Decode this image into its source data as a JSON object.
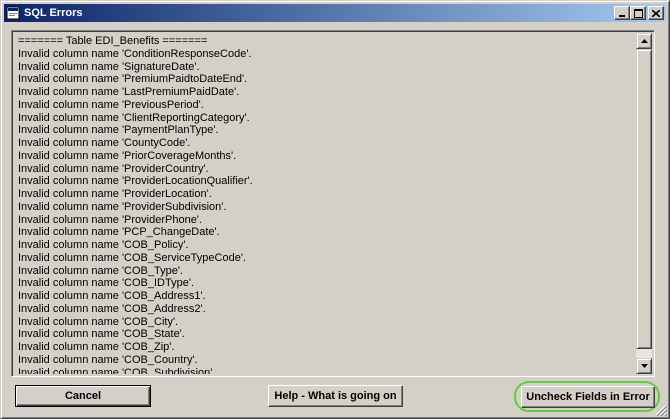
{
  "window": {
    "title": "SQL Errors",
    "controls": {
      "minimize": "minimize-icon",
      "maximize": "maximize-icon",
      "close": "close-icon"
    }
  },
  "log": {
    "lines": [
      "======= Table EDI_Benefits =======",
      "Invalid column name 'ConditionResponseCode'.",
      "Invalid column name 'SignatureDate'.",
      "Invalid column name 'PremiumPaidtoDateEnd'.",
      "Invalid column name 'LastPremiumPaidDate'.",
      "Invalid column name 'PreviousPeriod'.",
      "Invalid column name 'ClientReportingCategory'.",
      "Invalid column name 'PaymentPlanType'.",
      "Invalid column name 'CountyCode'.",
      "Invalid column name 'PriorCoverageMonths'.",
      "Invalid column name 'ProviderCountry'.",
      "Invalid column name 'ProviderLocationQualifier'.",
      "Invalid column name 'ProviderLocation'.",
      "Invalid column name 'ProviderSubdivision'.",
      "Invalid column name 'ProviderPhone'.",
      "Invalid column name 'PCP_ChangeDate'.",
      "Invalid column name 'COB_Policy'.",
      "Invalid column name 'COB_ServiceTypeCode'.",
      "Invalid column name 'COB_Type'.",
      "Invalid column name 'COB_IDType'.",
      "Invalid column name 'COB_Address1'.",
      "Invalid column name 'COB_Address2'.",
      "Invalid column name 'COB_City'.",
      "Invalid column name 'COB_State'.",
      "Invalid column name 'COB_Zip'.",
      "Invalid column name 'COB_Country'.",
      "Invalid column name 'COB_Subdivision'."
    ]
  },
  "buttons": {
    "cancel": "Cancel",
    "help": "Help - What is going on",
    "uncheck": "Uncheck Fields in Error"
  },
  "colors": {
    "titlebar_start": "#0a246a",
    "titlebar_end": "#a6caf0",
    "highlight": "#5fcf3f",
    "face": "#d4d0c8"
  }
}
